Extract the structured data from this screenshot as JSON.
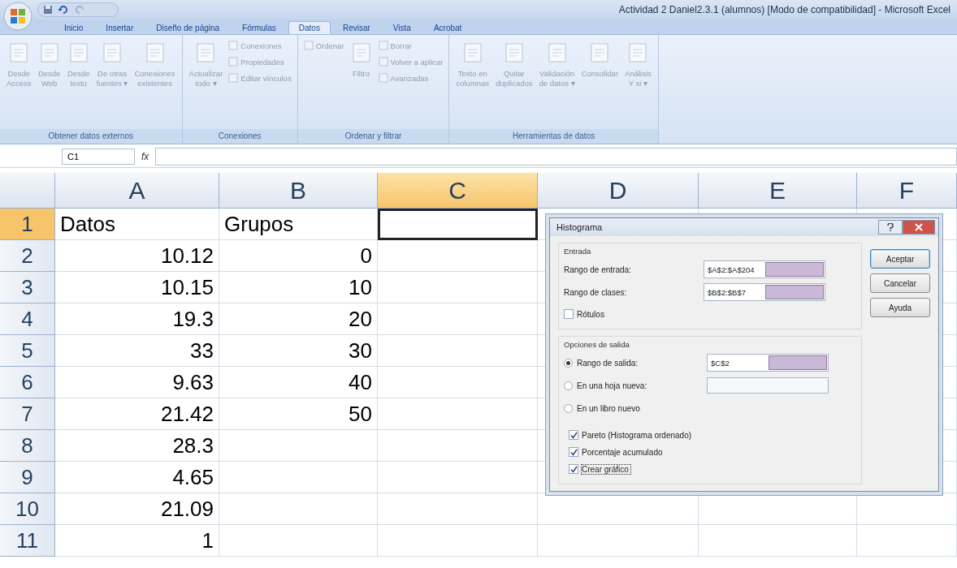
{
  "window": {
    "title": "Actividad 2 Daniel2.3.1 (alumnos) [Modo de compatibilidad] - Microsoft Excel"
  },
  "tabs": [
    {
      "label": "Inicio",
      "selected": false
    },
    {
      "label": "Insertar",
      "selected": false
    },
    {
      "label": "Diseño de página",
      "selected": false
    },
    {
      "label": "Fórmulas",
      "selected": false
    },
    {
      "label": "Datos",
      "selected": true
    },
    {
      "label": "Revisar",
      "selected": false
    },
    {
      "label": "Vista",
      "selected": false
    },
    {
      "label": "Acrobat",
      "selected": false
    }
  ],
  "ribbon": {
    "groups": [
      {
        "label": "Obtener datos externos",
        "commands": [
          {
            "kind": "large",
            "lines": [
              "Desde",
              "Access"
            ]
          },
          {
            "kind": "large",
            "lines": [
              "Desde",
              "Web"
            ]
          },
          {
            "kind": "large",
            "lines": [
              "Desde",
              "texto"
            ]
          },
          {
            "kind": "large",
            "lines": [
              "De otras",
              "fuentes ▾"
            ]
          },
          {
            "kind": "large",
            "lines": [
              "Conexiones",
              "existentes"
            ]
          }
        ]
      },
      {
        "label": "Conexiones",
        "commands": [
          {
            "kind": "large",
            "lines": [
              "Actualizar",
              "todo ▾"
            ]
          },
          {
            "kind": "small",
            "lines": [
              "Conexiones"
            ]
          },
          {
            "kind": "small",
            "lines": [
              "Propiedades"
            ]
          },
          {
            "kind": "small",
            "lines": [
              "Editar vínculos"
            ]
          }
        ]
      },
      {
        "label": "Ordenar y filtrar",
        "commands": [
          {
            "kind": "small",
            "lines": [
              "Ordenar"
            ]
          },
          {
            "kind": "large",
            "lines": [
              "Filtro"
            ]
          },
          {
            "kind": "small",
            "lines": [
              "Borrar"
            ]
          },
          {
            "kind": "small",
            "lines": [
              "Volver a aplicar"
            ]
          },
          {
            "kind": "small",
            "lines": [
              "Avanzadas"
            ]
          }
        ]
      },
      {
        "label": "Herramientas de datos",
        "commands": [
          {
            "kind": "large",
            "lines": [
              "Texto en",
              "columnas"
            ]
          },
          {
            "kind": "large",
            "lines": [
              "Quitar",
              "duplicados"
            ]
          },
          {
            "kind": "large",
            "lines": [
              "Validación",
              "de datos ▾"
            ]
          },
          {
            "kind": "large",
            "lines": [
              "Consolidar"
            ]
          },
          {
            "kind": "large",
            "lines": [
              "Análisis",
              "Y si ▾"
            ]
          }
        ]
      }
    ]
  },
  "formula_bar": {
    "name_box": "C1",
    "function_label": "fx"
  },
  "sheet": {
    "columns": [
      {
        "label": "A",
        "selected": false
      },
      {
        "label": "B",
        "selected": false
      },
      {
        "label": "C",
        "selected": true
      },
      {
        "label": "D",
        "selected": false
      },
      {
        "label": "E",
        "selected": false
      },
      {
        "label": "F",
        "selected": false
      }
    ],
    "rows": [
      {
        "header": "1",
        "selected": true,
        "cells": [
          {
            "value": "Datos",
            "kind": "text"
          },
          {
            "value": "Grupos",
            "kind": "text"
          }
        ]
      },
      {
        "header": "2",
        "selected": false,
        "cells": [
          {
            "value": "10.12",
            "kind": "number"
          },
          {
            "value": "0",
            "kind": "number"
          }
        ]
      },
      {
        "header": "3",
        "selected": false,
        "cells": [
          {
            "value": "10.15",
            "kind": "number"
          },
          {
            "value": "10",
            "kind": "number"
          }
        ]
      },
      {
        "header": "4",
        "selected": false,
        "cells": [
          {
            "value": "19.3",
            "kind": "number"
          },
          {
            "value": "20",
            "kind": "number"
          }
        ]
      },
      {
        "header": "5",
        "selected": false,
        "cells": [
          {
            "value": "33",
            "kind": "number"
          },
          {
            "value": "30",
            "kind": "number"
          }
        ]
      },
      {
        "header": "6",
        "selected": false,
        "cells": [
          {
            "value": "9.63",
            "kind": "number"
          },
          {
            "value": "40",
            "kind": "number"
          }
        ]
      },
      {
        "header": "7",
        "selected": false,
        "cells": [
          {
            "value": "21.42",
            "kind": "number"
          },
          {
            "value": "50",
            "kind": "number"
          }
        ]
      },
      {
        "header": "8",
        "selected": false,
        "cells": [
          {
            "value": "28.3",
            "kind": "number"
          }
        ]
      },
      {
        "header": "9",
        "selected": false,
        "cells": [
          {
            "value": "4.65",
            "kind": "number"
          }
        ]
      },
      {
        "header": "10",
        "selected": false,
        "cells": [
          {
            "value": "21.09",
            "kind": "number"
          }
        ]
      },
      {
        "header": "11",
        "selected": false,
        "cells": [
          {
            "value": "1",
            "kind": "number"
          }
        ]
      }
    ]
  },
  "dialog": {
    "title": "Histograma",
    "input_section": {
      "label": "Entrada",
      "fields": [
        {
          "label": "Rango de entrada:",
          "value": "$A$2:$A$204"
        },
        {
          "label": "Rango de clases:",
          "value": "$B$2:$B$7"
        }
      ],
      "labels_checkbox": {
        "label": "Rótulos",
        "checked": false
      }
    },
    "output_section": {
      "label": "Opciones de salida",
      "options": [
        {
          "label": "Rango de salida:",
          "selected": true,
          "kind": "range",
          "value": "$C$2"
        },
        {
          "label": "En una hoja nueva:",
          "selected": false,
          "kind": "field"
        },
        {
          "label": "En un libro nuevo",
          "selected": false,
          "kind": "plain"
        }
      ]
    },
    "checkboxes": [
      {
        "label": "Pareto (Histograma ordenado)",
        "checked": true,
        "focused": false
      },
      {
        "label": "Porcentaje acumulado",
        "checked": true,
        "focused": false
      },
      {
        "label": "Crear gráfico",
        "checked": true,
        "focused": true
      }
    ],
    "buttons": [
      {
        "label": "Aceptar",
        "default": true
      },
      {
        "label": "Cancelar",
        "default": false
      },
      {
        "label": "Ayuda",
        "default": false
      }
    ]
  }
}
